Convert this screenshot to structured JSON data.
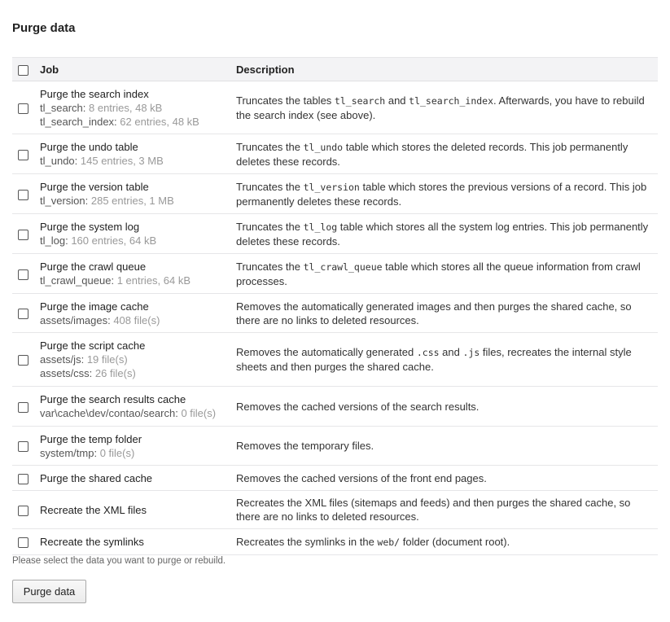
{
  "page": {
    "title": "Purge data"
  },
  "table": {
    "col_job": "Job",
    "col_description": "Description",
    "rows": [
      {
        "title": "Purge the search index",
        "meta": [
          {
            "label": "tl_search:",
            "count": "8 entries, 48 kB"
          },
          {
            "label": "tl_search_index:",
            "count": "62 entries, 48 kB"
          }
        ],
        "desc": [
          {
            "t": "Truncates the tables "
          },
          {
            "c": "tl_search"
          },
          {
            "t": " and "
          },
          {
            "c": "tl_search_index"
          },
          {
            "t": ". Afterwards, you have to rebuild the search index (see above)."
          }
        ]
      },
      {
        "title": "Purge the undo table",
        "meta": [
          {
            "label": "tl_undo:",
            "count": "145 entries, 3 MB"
          }
        ],
        "desc": [
          {
            "t": "Truncates the "
          },
          {
            "c": "tl_undo"
          },
          {
            "t": " table which stores the deleted records. This job permanently deletes these records."
          }
        ]
      },
      {
        "title": "Purge the version table",
        "meta": [
          {
            "label": "tl_version:",
            "count": "285 entries, 1 MB"
          }
        ],
        "desc": [
          {
            "t": "Truncates the "
          },
          {
            "c": "tl_version"
          },
          {
            "t": " table which stores the previous versions of a record. This job permanently deletes these records."
          }
        ]
      },
      {
        "title": "Purge the system log",
        "meta": [
          {
            "label": "tl_log:",
            "count": "160 entries, 64 kB"
          }
        ],
        "desc": [
          {
            "t": "Truncates the "
          },
          {
            "c": "tl_log"
          },
          {
            "t": " table which stores all the system log entries. This job permanently deletes these records."
          }
        ]
      },
      {
        "title": "Purge the crawl queue",
        "meta": [
          {
            "label": "tl_crawl_queue:",
            "count": "1 entries, 64 kB"
          }
        ],
        "desc": [
          {
            "t": "Truncates the "
          },
          {
            "c": "tl_crawl_queue"
          },
          {
            "t": " table which stores all the queue information from crawl processes."
          }
        ]
      },
      {
        "title": "Purge the image cache",
        "meta": [
          {
            "label": "assets/images:",
            "count": "408 file(s)"
          }
        ],
        "desc": [
          {
            "t": "Removes the automatically generated images and then purges the shared cache, so there are no links to deleted resources."
          }
        ]
      },
      {
        "title": "Purge the script cache",
        "meta": [
          {
            "label": "assets/js:",
            "count": "19 file(s)"
          },
          {
            "label": "assets/css:",
            "count": "26 file(s)"
          }
        ],
        "desc": [
          {
            "t": "Removes the automatically generated "
          },
          {
            "c": ".css"
          },
          {
            "t": " and "
          },
          {
            "c": ".js"
          },
          {
            "t": " files, recreates the internal style sheets and then purges the shared cache."
          }
        ]
      },
      {
        "title": "Purge the search results cache",
        "meta": [
          {
            "label": "var\\cache\\dev/contao/search:",
            "count": "0 file(s)"
          }
        ],
        "desc": [
          {
            "t": "Removes the cached versions of the search results."
          }
        ]
      },
      {
        "title": "Purge the temp folder",
        "meta": [
          {
            "label": "system/tmp:",
            "count": "0 file(s)"
          }
        ],
        "desc": [
          {
            "t": "Removes the temporary files."
          }
        ]
      },
      {
        "title": "Purge the shared cache",
        "meta": [],
        "desc": [
          {
            "t": "Removes the cached versions of the front end pages."
          }
        ]
      },
      {
        "title": "Recreate the XML files",
        "meta": [],
        "desc": [
          {
            "t": "Recreates the XML files (sitemaps and feeds) and then purges the shared cache, so there are no links to deleted resources."
          }
        ]
      },
      {
        "title": "Recreate the symlinks",
        "meta": [],
        "desc": [
          {
            "t": "Recreates the symlinks in the "
          },
          {
            "c": "web/"
          },
          {
            "t": " folder (document root)."
          }
        ]
      }
    ]
  },
  "hint": "Please select the data you want to purge or rebuild.",
  "submit_label": "Purge data"
}
